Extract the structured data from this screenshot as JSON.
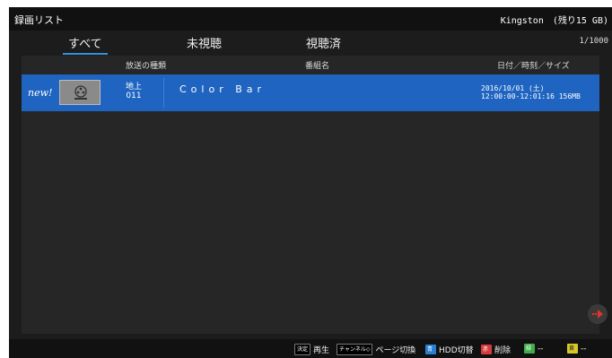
{
  "header": {
    "title": "録画リスト",
    "storage": "Kingston　(残り15 GB)"
  },
  "tabs": [
    {
      "label": "すべて",
      "active": true
    },
    {
      "label": "未視聴",
      "active": false
    },
    {
      "label": "視聴済",
      "active": false
    }
  ],
  "page_count": "1/1000",
  "columns": {
    "broadcast_type": "放送の種類",
    "program_name": "番組名",
    "datetime_size": "日付／時刻／サイズ"
  },
  "recordings": [
    {
      "badge": "new!",
      "thumb_icon": "film-reel-icon",
      "broadcast": "地上",
      "channel": "011",
      "title": "Color Bar",
      "date": "2016/10/01 (土)",
      "time_size": "12:00:00-12:01:16 156MB",
      "selected": true
    }
  ],
  "footer": {
    "play": {
      "key": "決定",
      "label": "再生"
    },
    "page_switch": {
      "key": "チャンネル◇",
      "label": "ページ切換"
    },
    "hdd_switch": {
      "key": "青",
      "label": "HDD切替"
    },
    "delete": {
      "key": "赤",
      "label": "削除"
    },
    "green_action": {
      "key": "緑",
      "label": "--"
    },
    "yellow_action": {
      "key": "黄",
      "label": "--"
    }
  },
  "colors": {
    "selection": "#1f64c0",
    "tab_underline": "#2f8fe0",
    "background": "#1c1c1c"
  }
}
